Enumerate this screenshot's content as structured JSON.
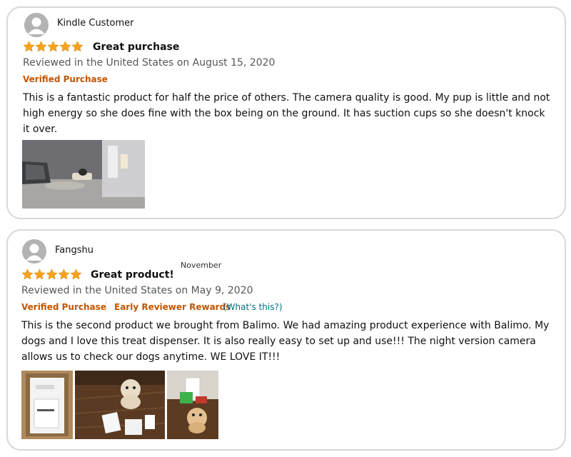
{
  "reviews": [
    {
      "author": "Kindle Customer",
      "rating": 5,
      "title": "Great purchase",
      "reviewed_line": "Reviewed in the United States on August 15, 2020",
      "verified": "Verified Purchase",
      "body": "This is a fantastic product for half the price of others. The camera quality is good. My pup is little and not high energy so she does fine with the box being on the ground. It has suction cups so she doesn't knock it over."
    },
    {
      "author": "Fangshu",
      "rating": 5,
      "title": "Great product!",
      "floating_label": "November",
      "reviewed_line": "Reviewed in the United States on May 9, 2020",
      "verified": "Verified Purchase",
      "early_reviewer": "Early Reviewer Rewards",
      "whats_this": "(What's this?)",
      "body": "This is the second product we brought from Balimo. We had amazing product experience with Balimo. My dogs and I love this treat dispenser. It is also really easy to set up and use!!! The night version camera allows us to check our dogs anytime. WE LOVE IT!!!"
    }
  ],
  "colors": {
    "star": "#f7a21b",
    "verified": "#c45500",
    "link": "#007185",
    "meta": "#565959",
    "border": "#d5d9d9"
  },
  "icons": {
    "avatar": "default-user-avatar-icon",
    "star": "filled-star-icon"
  }
}
